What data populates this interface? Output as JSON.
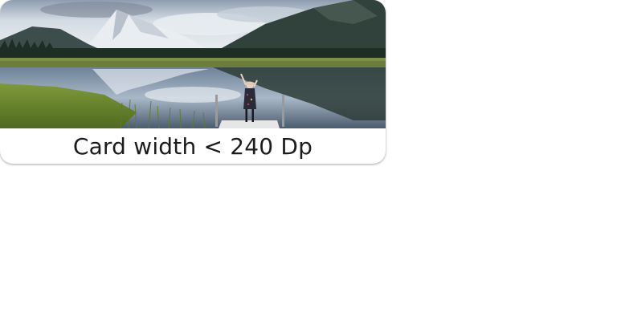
{
  "card": {
    "image_alt": "mountain-lake-photo",
    "caption": "Card width < 240 Dp"
  },
  "colors": {
    "sky": "#c9d3dd",
    "mountain_dark": "#2f3f3a",
    "water": "#7f93a8",
    "grass": "#6f8a2e",
    "caption_text": "#1c1c1c"
  }
}
